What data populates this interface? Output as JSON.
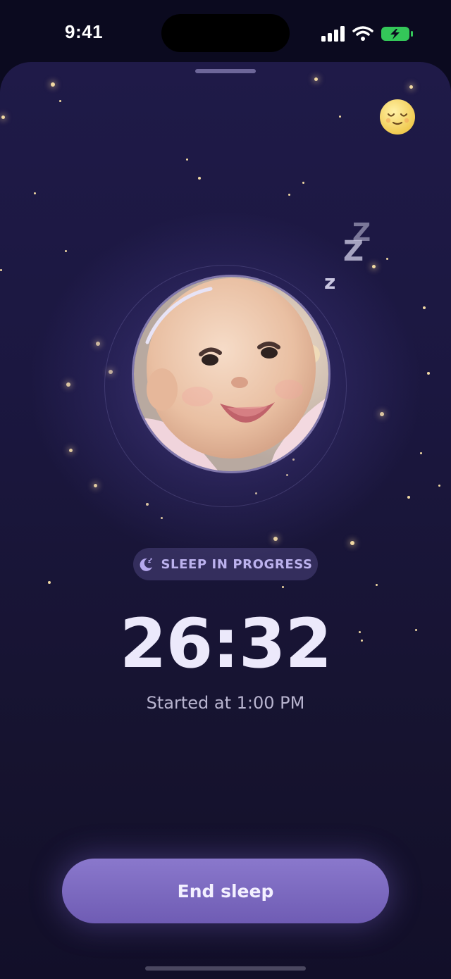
{
  "status_bar": {
    "time": "9:41"
  },
  "sleep": {
    "badge": "SLEEP IN PROGRESS",
    "timer": "26:32",
    "started": "Started at 1:00 PM"
  },
  "actions": {
    "end_label": "End sleep"
  },
  "icons": [
    "signal-icon",
    "wifi-icon",
    "battery-charging-icon",
    "sleeping-face-icon",
    "moon-zzz-icon"
  ],
  "colors": {
    "accent": "#7c68c0",
    "background": "#1b1740",
    "battery": "#34c759",
    "badge_text": "#bcb2ee"
  }
}
